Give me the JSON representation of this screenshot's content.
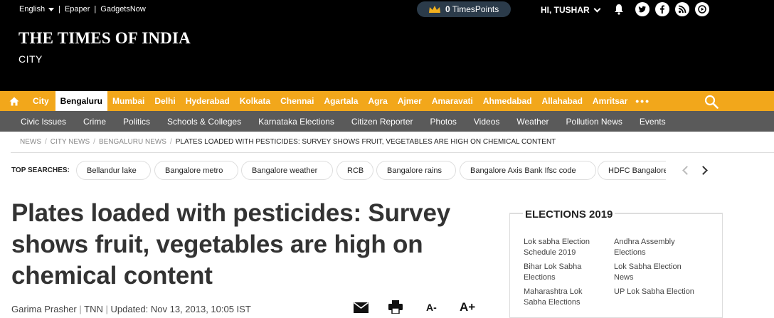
{
  "topbar": {
    "language": "English",
    "links": [
      "Epaper",
      "GadgetsNow"
    ],
    "points_value": "0",
    "points_label": "TimesPoints",
    "user_greeting": "HI, TUSHAR",
    "social_icons": [
      "bell-icon",
      "twitter-icon",
      "facebook-icon",
      "rss-icon",
      "youtube-icon"
    ]
  },
  "masthead": {
    "logo": "THE TIMES OF INDIA",
    "section": "CITY"
  },
  "city_nav": {
    "tag": "City",
    "active": "Bengaluru",
    "cities": [
      "Mumbai",
      "Delhi",
      "Hyderabad",
      "Kolkata",
      "Chennai",
      "Agartala",
      "Agra",
      "Ajmer",
      "Amaravati",
      "Ahmedabad",
      "Allahabad",
      "Amritsar"
    ],
    "more": "•••"
  },
  "section_nav": [
    "Civic Issues",
    "Crime",
    "Politics",
    "Schools & Colleges",
    "Karnataka Elections",
    "Citizen Reporter",
    "Photos",
    "Videos",
    "Weather",
    "Pollution News",
    "Events"
  ],
  "breadcrumb": [
    "NEWS",
    "CITY NEWS",
    "BENGALURU NEWS",
    "PLATES LOADED WITH PESTICIDES: SURVEY SHOWS FRUIT, VEGETABLES ARE HIGH ON CHEMICAL CONTENT"
  ],
  "top_searches": {
    "label": "TOP SEARCHES:",
    "chips": [
      "Bellandur lake",
      "Bangalore metro",
      "Bangalore weather",
      "RCB",
      "Bangalore rains",
      "Bangalore Axis Bank Ifsc code",
      "HDFC Bangalore"
    ]
  },
  "article": {
    "headline": "Plates loaded with pesticides: Survey shows fruit, vegetables are high on chemical content",
    "author": "Garima Prasher",
    "source": "TNN",
    "updated": "Updated: Nov 13, 2013, 10:05 IST",
    "font_smaller": "A-",
    "font_larger": "A+"
  },
  "elections": {
    "title": "ELECTIONS 2019",
    "links": [
      "Lok sabha Election Schedule 2019",
      "Andhra Assembly Elections",
      "Bihar Lok Sabha Elections",
      "Lok Sabha Election News",
      "Maharashtra Lok Sabha Elections",
      "UP Lok Sabha Election"
    ]
  },
  "colors": {
    "accent": "#f2a71b",
    "secondary_nav": "#5a5a5a",
    "masthead": "#000000"
  }
}
